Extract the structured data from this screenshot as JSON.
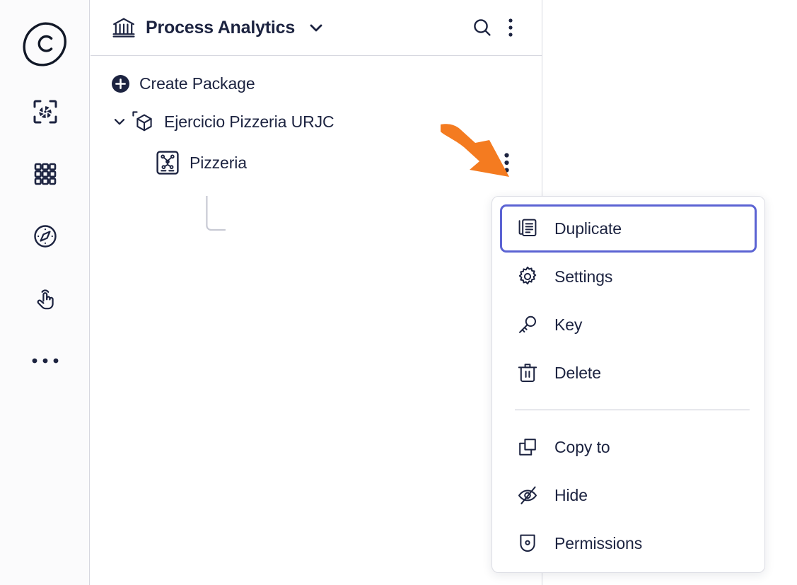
{
  "app": {
    "logo_icon": "celonis-blob-c-logo",
    "background": "#ffffff",
    "accent_navy": "#1c2340",
    "selection_border": "#5b63d3",
    "annotation_orange": "#f47b20",
    "border_gray": "#d7d8e0"
  },
  "rail": {
    "items": [
      {
        "name": "logo",
        "icon": "celonis-logo-icon",
        "label": ""
      },
      {
        "name": "studio",
        "icon": "aperture-frame-icon",
        "label": ""
      },
      {
        "name": "apps",
        "icon": "grid-apps-icon",
        "label": ""
      },
      {
        "name": "explore",
        "icon": "compass-icon",
        "label": ""
      },
      {
        "name": "action",
        "icon": "hand-pointer-icon",
        "label": ""
      },
      {
        "name": "more",
        "icon": "ellipsis-icon",
        "label": ""
      }
    ]
  },
  "panel": {
    "header": {
      "space_icon": "bank-columns-icon",
      "title": "Process Analytics",
      "caret_icon": "chevron-down-icon",
      "search_icon": "search-icon",
      "overflow_icon": "kebab-menu-icon"
    },
    "create": {
      "icon": "plus-circle-icon",
      "label": "Create Package"
    },
    "tree": [
      {
        "type": "package",
        "caret_icon": "chevron-down-icon",
        "icon": "package-cube-icon",
        "label": "Ejercicio Pizzeria URJC",
        "expanded": true
      },
      {
        "type": "asset",
        "icon": "process-analysis-icon",
        "label": "Pizzeria",
        "kebab_icon": "kebab-menu-icon"
      }
    ]
  },
  "annotation": {
    "type": "arrow",
    "color": "#f47b20",
    "points_to": "pizzeria-row-kebab-menu"
  },
  "context_menu": {
    "groups": [
      {
        "items": [
          {
            "label": "Duplicate",
            "icon": "duplicate-icon",
            "selected": true
          },
          {
            "label": "Settings",
            "icon": "gear-icon",
            "selected": false
          },
          {
            "label": "Key",
            "icon": "key-icon",
            "selected": false
          },
          {
            "label": "Delete",
            "icon": "trash-icon",
            "selected": false
          }
        ]
      },
      {
        "items": [
          {
            "label": "Copy to",
            "icon": "copy-to-icon",
            "selected": false
          },
          {
            "label": "Hide",
            "icon": "eye-off-icon",
            "selected": false
          },
          {
            "label": "Permissions",
            "icon": "shield-dot-icon",
            "selected": false
          }
        ]
      }
    ]
  }
}
